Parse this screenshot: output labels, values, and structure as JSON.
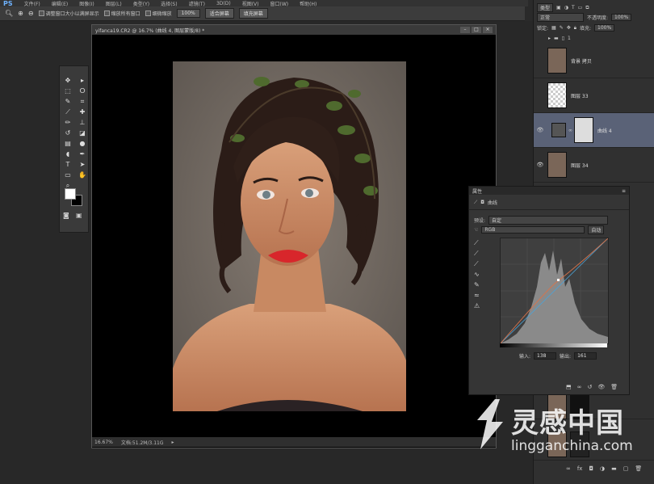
{
  "app": {
    "logo": "PS",
    "menus": [
      "文件(F)",
      "编辑(E)",
      "图像(I)",
      "图层(L)",
      "类型(Y)",
      "选择(S)",
      "滤镜(T)",
      "3D(D)",
      "视图(V)",
      "窗口(W)",
      "帮助(H)"
    ]
  },
  "options": {
    "resize_windows_label": "调整窗口大小以满屏显示",
    "zoom_all_label": "缩放所有窗口",
    "scrubby_zoom_label": "细微缩放",
    "zoom_100_label": "100%",
    "fit_screen_label": "适合屏幕",
    "fill_screen_label": "填充屏幕"
  },
  "document": {
    "tab_title": "yifanca19.CR2 @ 16.7% (曲线 4, 图层蒙版/8) *",
    "zoom": "16.67%",
    "doc_size": "文档:51.2M/3.11G"
  },
  "layers_panel": {
    "filter_kind": "类型",
    "blend_mode": "正常",
    "opacity_label": "不透明度:",
    "opacity_value": "100%",
    "lock_label": "锁定:",
    "fill_label": "填充:",
    "fill_value": "100%",
    "group_label": "1",
    "layers": [
      {
        "name": "背景 拷贝",
        "visible": false,
        "type": "portrait"
      },
      {
        "name": "图层 33",
        "visible": false,
        "type": "transparent"
      },
      {
        "name": "曲线 4",
        "visible": true,
        "type": "curves",
        "active": true
      },
      {
        "name": "图层 34",
        "visible": true,
        "type": "portrait"
      }
    ]
  },
  "properties_panel": {
    "title": "属性",
    "adjustment": "曲线",
    "preset_label": "预设:",
    "preset_value": "自定",
    "channel_value": "RGB",
    "auto_label": "自动",
    "input_label": "输入:",
    "input_value": "138",
    "output_label": "输出:",
    "output_value": "161"
  },
  "watermark": {
    "cn": "灵感中国",
    "url": "lingganchina.com"
  },
  "colors": {
    "foreground": "#ffffff",
    "background": "#000000",
    "active_layer": "#5a6277"
  }
}
